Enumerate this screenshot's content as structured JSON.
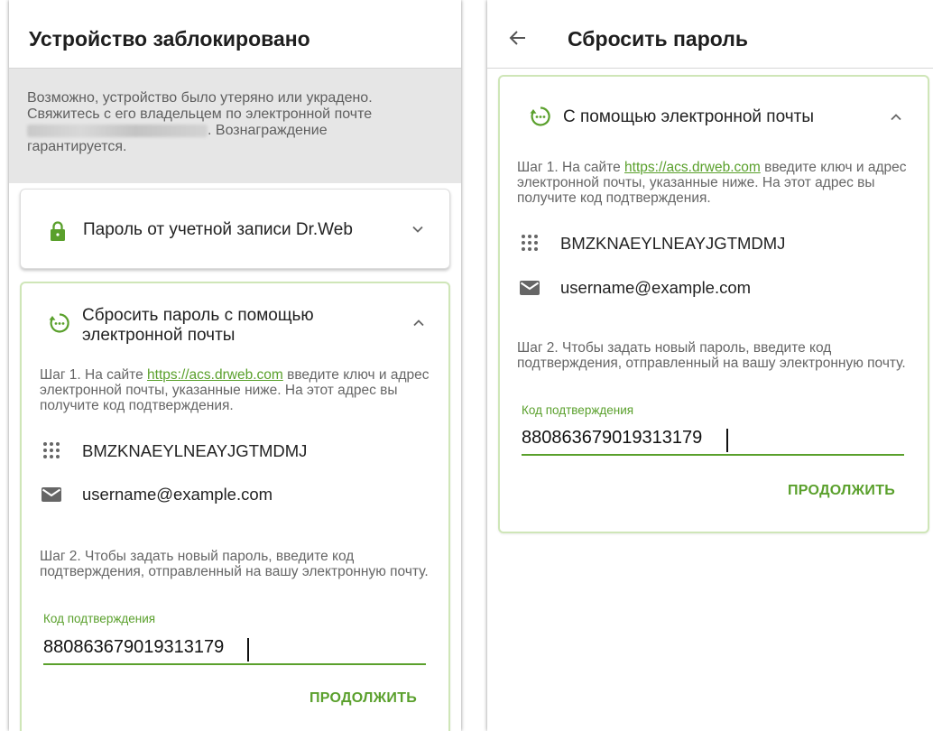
{
  "left": {
    "title": "Устройство заблокировано",
    "banner": {
      "text_before": "Возможно, устройство было утеряно или украдено. Свяжитесь с его владельцем по электронной почте ",
      "text_after": ". Вознаграждение гарантируется."
    },
    "account_card": {
      "label": "Пароль от учетной записи Dr.Web"
    },
    "reset_card": {
      "label": "Сбросить пароль с помощью электронной почты",
      "step1_prefix": "Шаг 1. На сайте ",
      "step1_link": "https://acs.drweb.com",
      "step1_suffix": " введите ключ и адрес электронной почты, указанные ниже. На этот адрес вы получите код подтверждения.",
      "key": "BMZKNAEYLNEAYJGTMDMJ",
      "email": "username@example.com",
      "step2": "Шаг 2. Чтобы задать новый пароль, введите код подтверждения, отправленный на вашу электронную почту.",
      "code_label": "Код подтверждения",
      "code_value": "880863679019313179",
      "continue": "ПРОДОЛЖИТЬ"
    }
  },
  "right": {
    "title": "Сбросить пароль",
    "card": {
      "label": "С помощью электронной почты",
      "step1_prefix": "Шаг 1. На сайте ",
      "step1_link": "https://acs.drweb.com",
      "step1_suffix": " введите ключ и адрес электронной почты, указанные ниже. На этот адрес вы получите код подтверждения.",
      "key": "BMZKNAEYLNEAYJGTMDMJ",
      "email": "username@example.com",
      "step2": "Шаг 2. Чтобы задать новый пароль, введите код подтверждения, отправленный на вашу электронную почту.",
      "code_label": "Код подтверждения",
      "code_value": "880863679019313179",
      "continue": "ПРОДОЛЖИТЬ"
    }
  },
  "colors": {
    "accent": "#5aa02c",
    "card_border": "#cfe6b8",
    "banner_bg": "#e6e6e6",
    "icon_gray": "#666666"
  },
  "icons": {
    "lock": "lock-icon",
    "reset": "reset-icon",
    "key": "keypad-icon",
    "mail": "mail-icon",
    "back": "arrow-back-icon",
    "expand": "chevron-down-icon",
    "collapse": "chevron-up-icon"
  }
}
